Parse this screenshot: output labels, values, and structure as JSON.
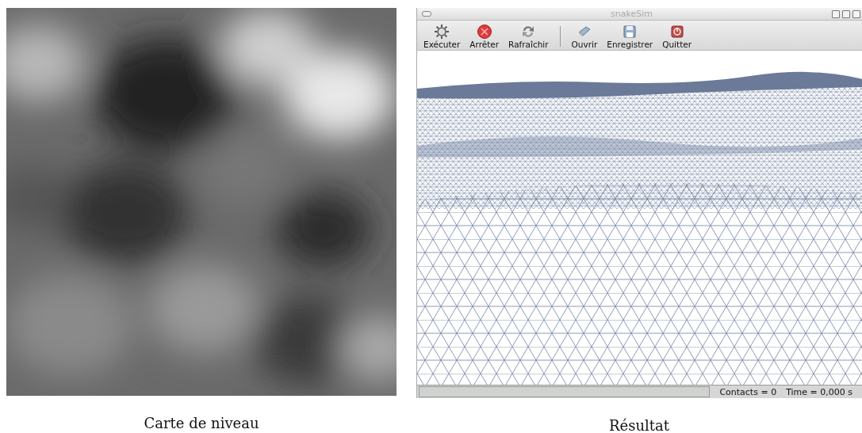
{
  "panels": [
    {
      "kind": "picture",
      "caption": "Carte de niveau"
    },
    {
      "kind": "window",
      "caption": "Résultat",
      "window": {
        "title": "snakeSim",
        "toolbar": [
          {
            "kind": "gear",
            "label": "Exécuter"
          },
          {
            "kind": "stop",
            "label": "Arrêter"
          },
          {
            "kind": "refresh",
            "label": "Rafraîchir"
          },
          {
            "kind": "separator"
          },
          {
            "kind": "open",
            "label": "Ouvrir"
          },
          {
            "kind": "save",
            "label": "Enregistrer"
          },
          {
            "kind": "quit",
            "label": "Quitter"
          }
        ],
        "status_bar": {
          "contacts": "Contacts = 0",
          "time": "Time = 0,000 s"
        }
      }
    }
  ]
}
